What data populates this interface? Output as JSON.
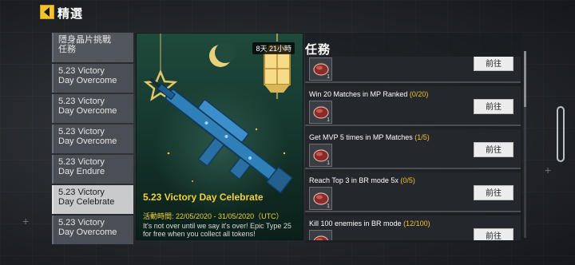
{
  "header": {
    "title": "精選"
  },
  "sidebar": {
    "items": [
      {
        "line1": "隱身晶片挑戰",
        "line2": "任務",
        "active": false
      },
      {
        "line1": "5.23 Victory",
        "line2": "Day Overcome",
        "active": false
      },
      {
        "line1": "5.23 Victory",
        "line2": "Day Overcome",
        "active": false
      },
      {
        "line1": "5.23 Victory",
        "line2": "Day Overcome",
        "active": false
      },
      {
        "line1": "5.23 Victory",
        "line2": "Day Endure",
        "active": false
      },
      {
        "line1": "5.23 Victory",
        "line2": "Day Celebrate",
        "active": true
      },
      {
        "line1": "5.23 Victory",
        "line2": "Day Overcome",
        "active": false
      }
    ]
  },
  "event": {
    "timer": "8天 21小時",
    "title": "5.23 Victory Day Celebrate",
    "date": "活動時間: 22/05/2020 - 31/05/2020（UTC）",
    "description": "It's not over until we say it's over! Epic Type 25 for free when you collect all tokens!"
  },
  "tasks": {
    "title": "任務",
    "go_label": "前往",
    "items": [
      {
        "name": "",
        "progress": "",
        "reward_qty": "1"
      },
      {
        "name": "Win 20 Matches in MP Ranked ",
        "progress": "(0/20)",
        "reward_qty": "1"
      },
      {
        "name": "Get MVP 5 times in MP Matches ",
        "progress": "(1/5)",
        "reward_qty": "1"
      },
      {
        "name": "Reach Top 3 in BR mode 5x ",
        "progress": "(0/5)",
        "reward_qty": "1"
      },
      {
        "name": "Kill 100 enemies in BR mode ",
        "progress": "(12/100)",
        "reward_qty": "1"
      }
    ]
  },
  "colors": {
    "accent_yellow": "#f2d23a",
    "progress_yellow": "#f2c230",
    "card_green": "#1f4a3c"
  },
  "icons": {
    "back": "back-arrow-icon",
    "token": "token-icon",
    "star": "star-ornament-icon",
    "lantern": "lantern-icon",
    "moon": "crescent-moon-icon"
  }
}
